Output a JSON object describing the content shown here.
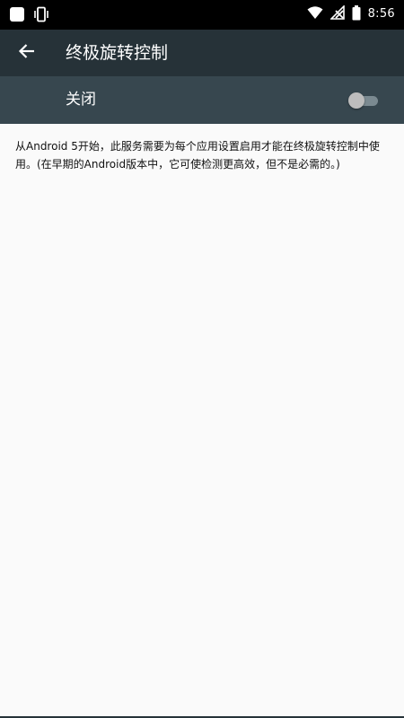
{
  "status_bar": {
    "time": "8:56",
    "left_icons": [
      "notification-square-icon",
      "vibrate-icon"
    ],
    "right_icons": [
      "wifi-icon",
      "no-signal-icon",
      "battery-icon"
    ]
  },
  "toolbar": {
    "title": "终极旋转控制",
    "back_icon": "arrow-left-icon",
    "background": "#263238"
  },
  "master_switch": {
    "label": "关闭",
    "state": "off",
    "background": "#37474f"
  },
  "description": {
    "text": "从Android 5开始，此服务需要为每个应用设置启用才能在终极旋转控制中使用。(在早期的Android版本中，它可使检测更高效，但不是必需的。)"
  }
}
